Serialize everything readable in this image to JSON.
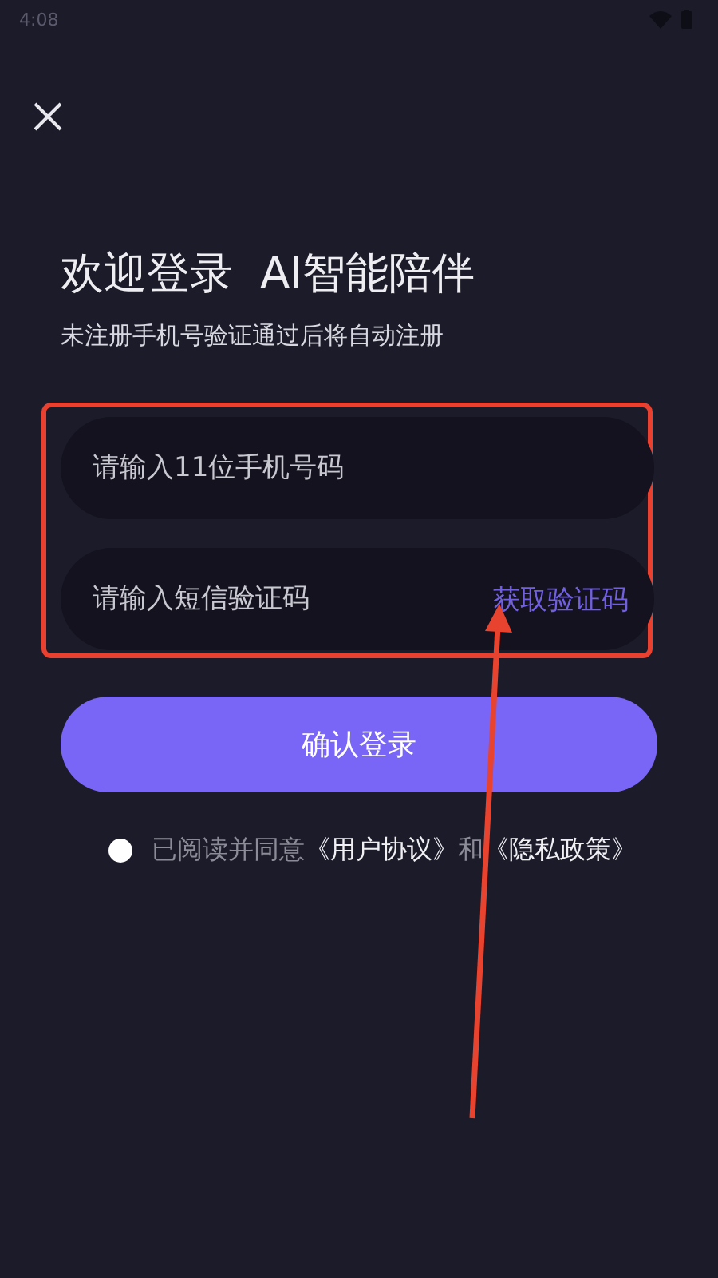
{
  "status_bar": {
    "time": "4:08"
  },
  "title": "欢迎登录  AI智能陪伴",
  "subtitle": "未注册手机号验证通过后将自动注册",
  "phone_field": {
    "placeholder": "请输入11位手机号码"
  },
  "code_field": {
    "placeholder": "请输入短信验证码",
    "action": "获取验证码"
  },
  "login_button": "确认登录",
  "agreement": {
    "checked": false,
    "parts": [
      {
        "kind": "text",
        "text": "已阅读并同意"
      },
      {
        "kind": "link",
        "text": "《用户协议》"
      },
      {
        "kind": "text",
        "text": "和"
      },
      {
        "kind": "link",
        "text": "《隐私政策》"
      }
    ]
  }
}
